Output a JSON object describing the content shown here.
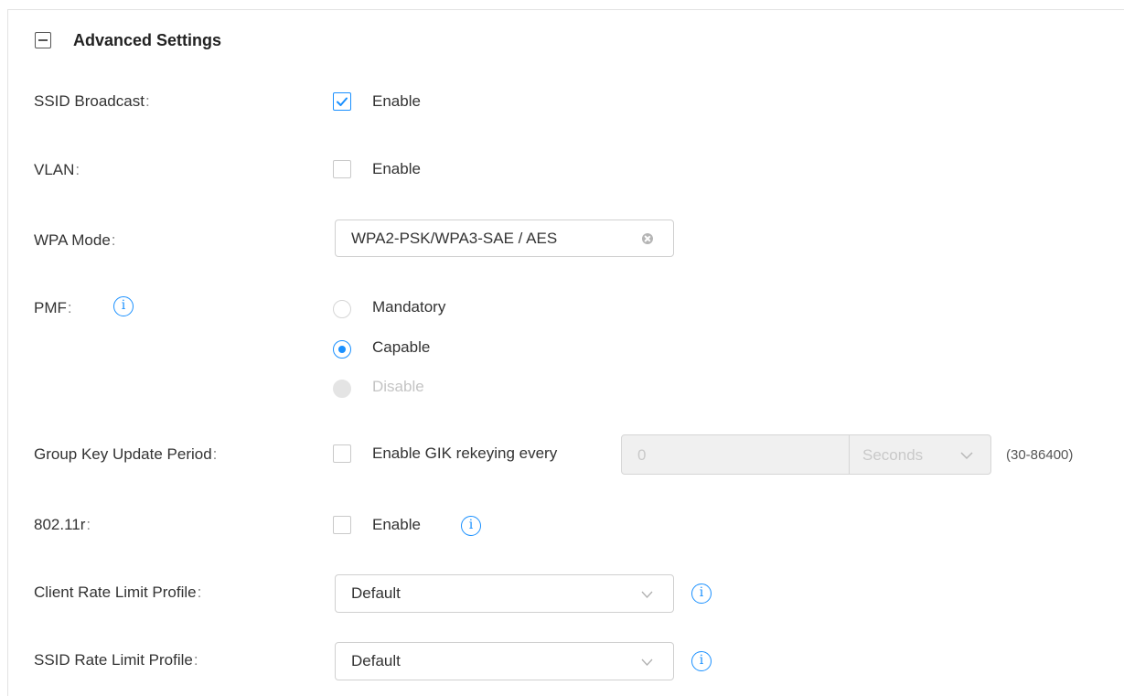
{
  "section": {
    "title": "Advanced Settings"
  },
  "ssid_broadcast": {
    "label": "SSID Broadcast",
    "checkbox_label": "Enable",
    "checked": true
  },
  "vlan": {
    "label": "VLAN",
    "checkbox_label": "Enable",
    "checked": false
  },
  "wpa_mode": {
    "label": "WPA Mode",
    "value": "WPA2-PSK/WPA3-SAE / AES"
  },
  "pmf": {
    "label": "PMF",
    "options": [
      {
        "label": "Mandatory",
        "selected": false,
        "disabled": false
      },
      {
        "label": "Capable",
        "selected": true,
        "disabled": false
      },
      {
        "label": "Disable",
        "selected": false,
        "disabled": true
      }
    ]
  },
  "group_key": {
    "label": "Group Key Update Period",
    "checkbox_label": "Enable GIK rekeying every",
    "checked": false,
    "value": "0",
    "unit": "Seconds",
    "range": "(30-86400)"
  },
  "dot11r": {
    "label": "802.11r",
    "checkbox_label": "Enable",
    "checked": false
  },
  "client_rate_limit": {
    "label": "Client Rate Limit Profile",
    "value": "Default"
  },
  "ssid_rate_limit": {
    "label": "SSID Rate Limit Profile",
    "value": "Default"
  },
  "colon": ":",
  "info_glyph": "i",
  "colors": {
    "accent": "#1a90ff",
    "text": "#333333",
    "disabled": "#c4c4c4"
  }
}
